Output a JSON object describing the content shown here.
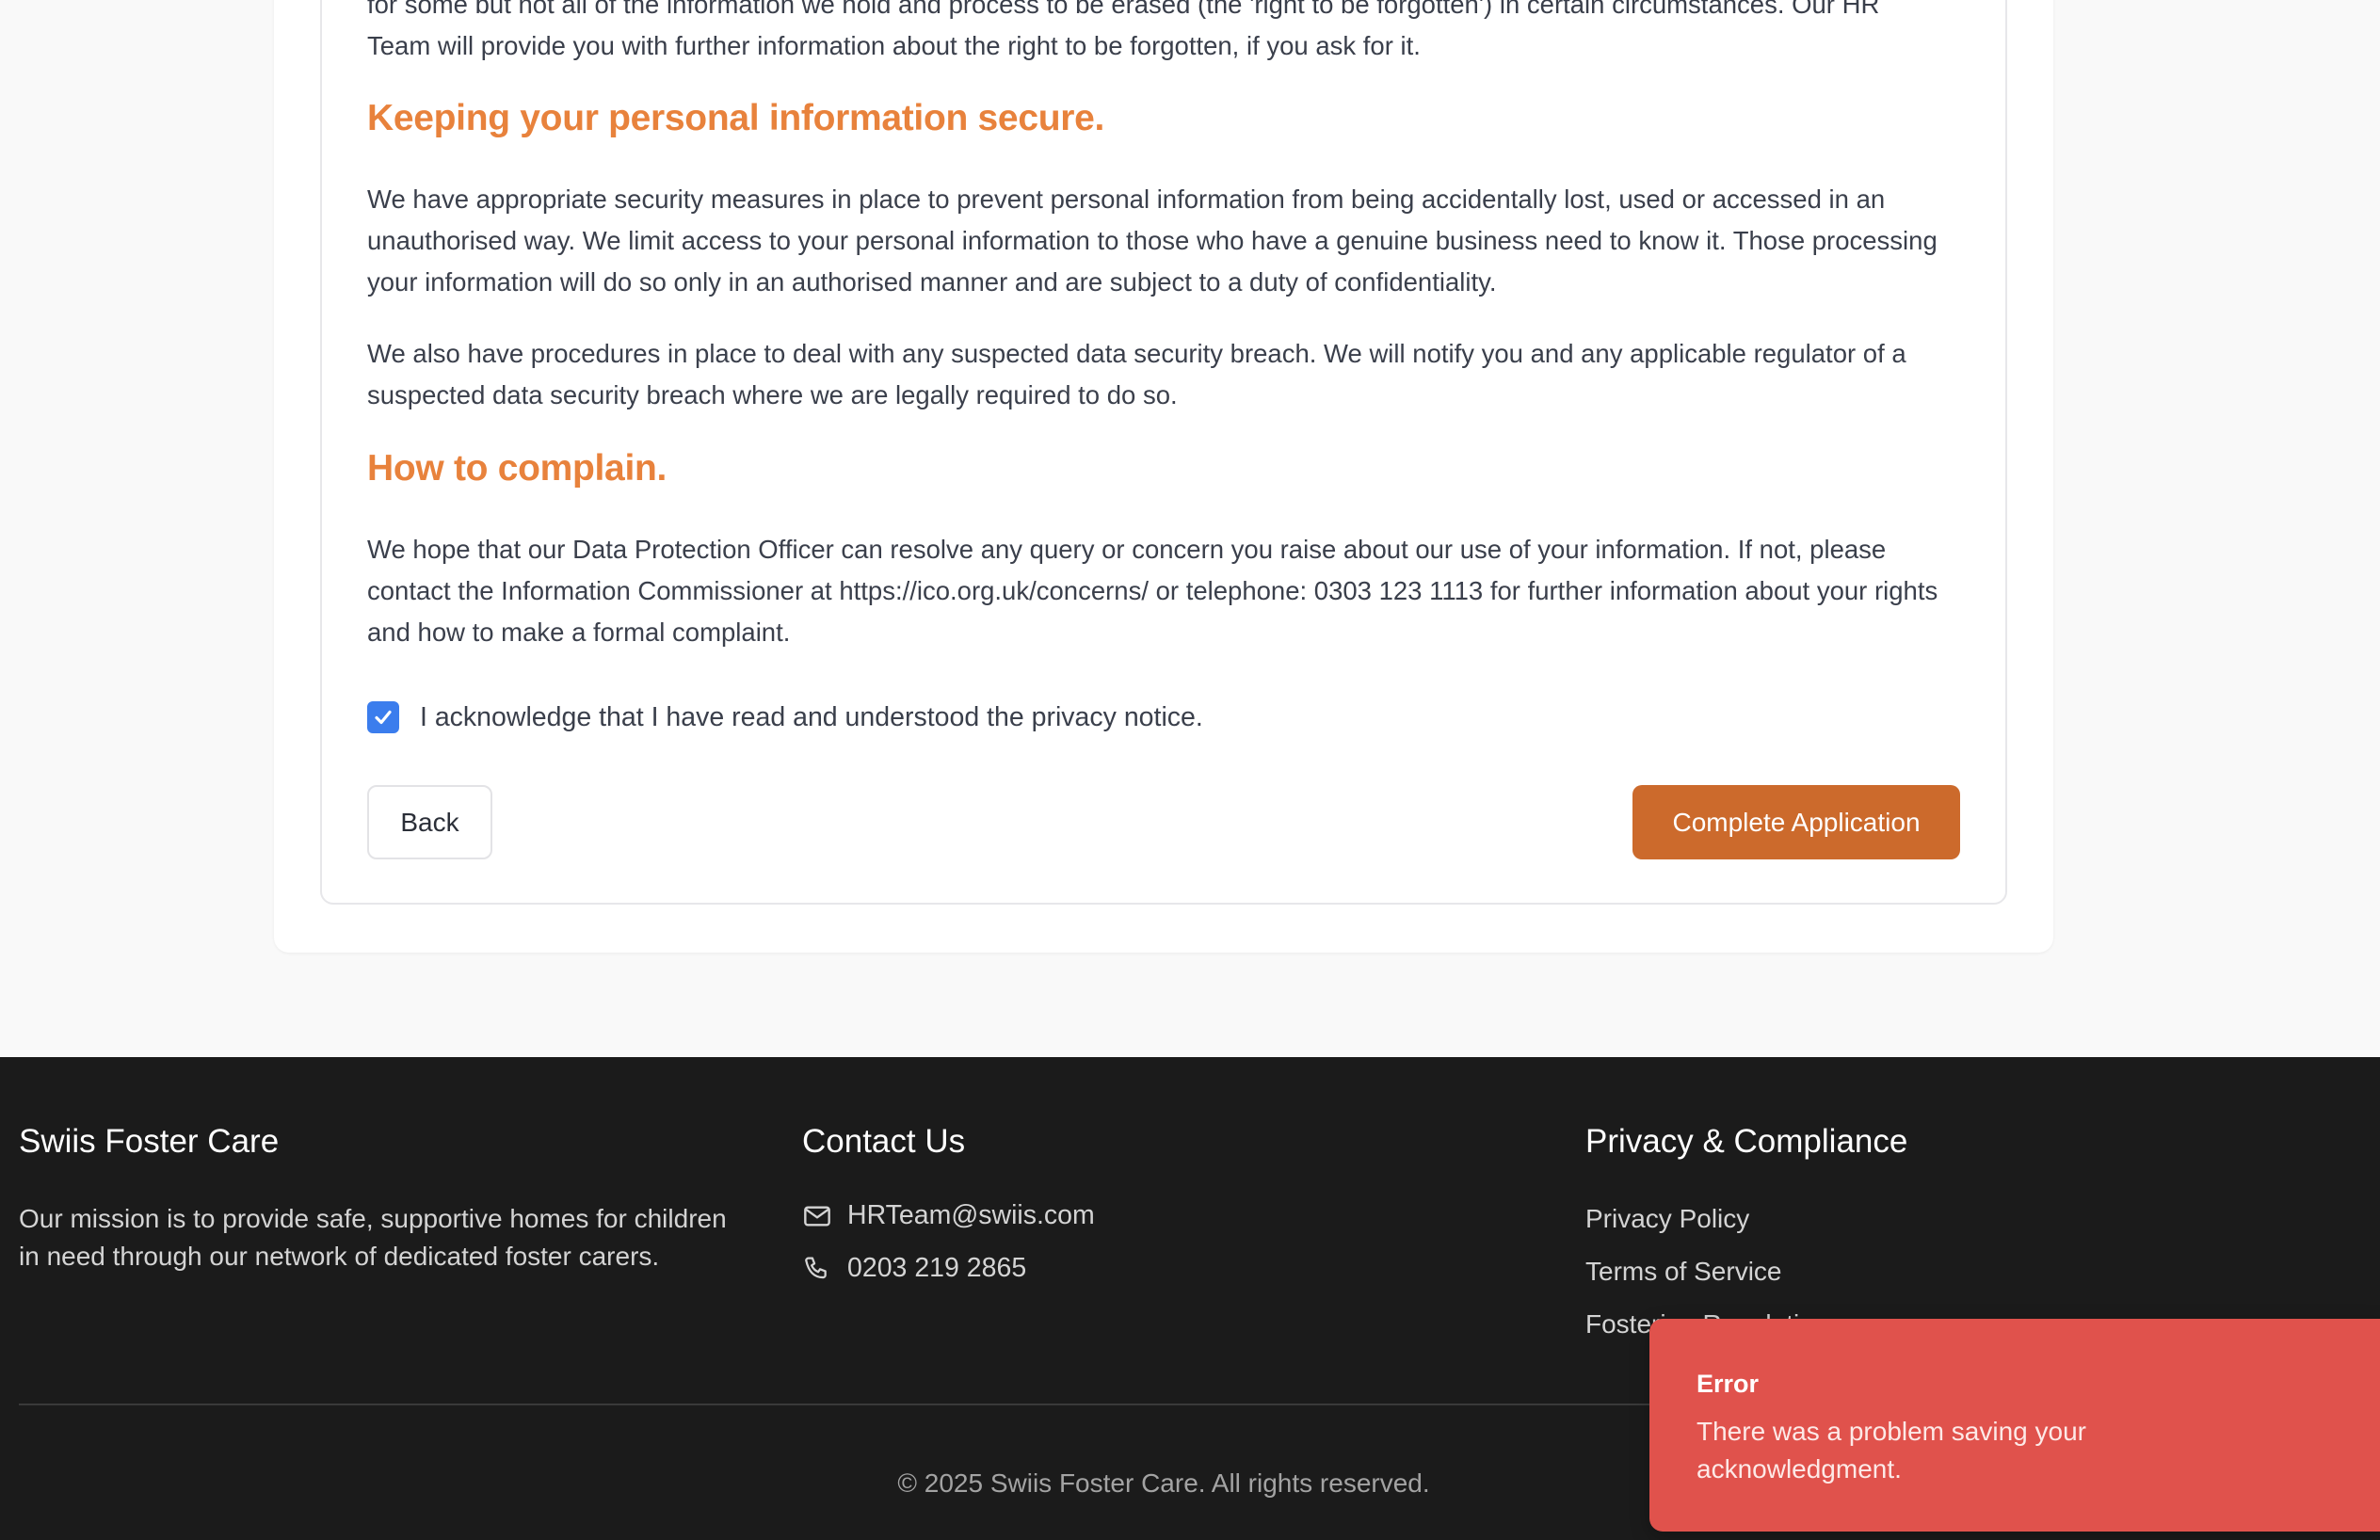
{
  "privacy": {
    "erasure_paragraph": "for some but not all of the information we hold and process to be erased (the 'right to be forgotten') in certain circumstances. Our HR Team will provide you with further information about the right to be forgotten, if you ask for it.",
    "security_heading": "Keeping your personal information secure.",
    "security_paragraph_1": "We have appropriate security measures in place to prevent personal information from being accidentally lost, used or accessed in an unauthorised way. We limit access to your personal information to those who have a genuine business need to know it. Those processing your information will do so only in an authorised manner and are subject to a duty of confidentiality.",
    "security_paragraph_2": "We also have procedures in place to deal with any suspected data security breach. We will notify you and any applicable regulator of a suspected data security breach where we are legally required to do so.",
    "complain_heading": "How to complain.",
    "complain_paragraph": "We hope that our Data Protection Officer can resolve any query or concern you raise about our use of your information. If not, please contact the Information Commissioner at https://ico.org.uk/concerns/ or telephone: 0303 123 1113 for further information about your rights and how to make a formal complaint.",
    "acknowledge_label": "I acknowledge that I have read and understood the privacy notice.",
    "acknowledge_checked": true
  },
  "actions": {
    "back_label": "Back",
    "complete_label": "Complete Application"
  },
  "footer": {
    "brand_title": "Swiis Foster Care",
    "mission": "Our mission is to provide safe, supportive homes for children in need through our network of dedicated foster carers.",
    "contact_title": "Contact Us",
    "email": "HRTeam@swiis.com",
    "phone": "0203 219 2865",
    "compliance_title": "Privacy & Compliance",
    "links": [
      "Privacy Policy",
      "Terms of Service",
      "Fostering Regulations"
    ],
    "copyright": "© 2025 Swiis Foster Care. All rights reserved."
  },
  "toast": {
    "title": "Error",
    "message": "There was a problem saving your acknowledgment."
  },
  "colors": {
    "heading": "#e8823c",
    "primary_button": "#cc6a2c",
    "checkbox": "#3b7ded",
    "footer_bg": "#1b1b1b",
    "toast_bg": "#e0524c"
  }
}
